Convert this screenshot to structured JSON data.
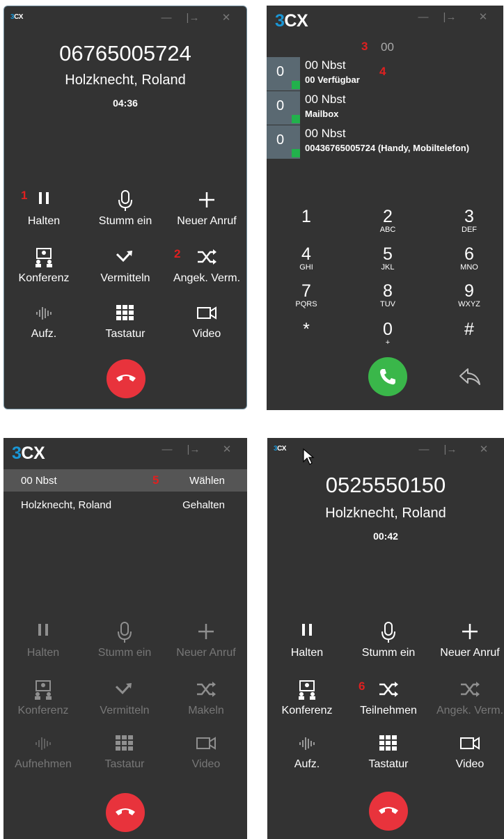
{
  "app": {
    "logo_prefix": "3",
    "logo_rest": "CX"
  },
  "window": {
    "minimize": "—",
    "dock": "|→",
    "close": "✕"
  },
  "panel1": {
    "number": "06765005724",
    "name": "Holzknecht, Roland",
    "timer": "04:36",
    "markers": [
      "1",
      "2"
    ],
    "controls": [
      "Halten",
      "Stumm ein",
      "Neuer Anruf",
      "Konferenz",
      "Vermitteln",
      "Angek. Verm.",
      "Aufz.",
      "Tastatur",
      "Video"
    ]
  },
  "panel2": {
    "marker3": "3",
    "marker4": "4",
    "dial_value": "00",
    "contacts": [
      {
        "avatar": "0",
        "name": "00 Nbst",
        "status": "00 Verfügbar"
      },
      {
        "avatar": "0",
        "name": "00 Nbst",
        "status": "Mailbox"
      },
      {
        "avatar": "0",
        "name": "00 Nbst",
        "status": "00436765005724 (Handy, Mobiltelefon)"
      }
    ],
    "keys": [
      {
        "d": "1",
        "l": ""
      },
      {
        "d": "2",
        "l": "ABC"
      },
      {
        "d": "3",
        "l": "DEF"
      },
      {
        "d": "4",
        "l": "GHI"
      },
      {
        "d": "5",
        "l": "JKL"
      },
      {
        "d": "6",
        "l": "MNO"
      },
      {
        "d": "7",
        "l": "PQRS"
      },
      {
        "d": "8",
        "l": "TUV"
      },
      {
        "d": "9",
        "l": "WXYZ"
      },
      {
        "d": "*",
        "l": ""
      },
      {
        "d": "0",
        "l": "+"
      },
      {
        "d": "#",
        "l": ""
      }
    ]
  },
  "panel3": {
    "marker5": "5",
    "rows": [
      {
        "name": "00 Nbst",
        "status": "Wählen"
      },
      {
        "name": "Holzknecht, Roland",
        "status": "Gehalten"
      }
    ],
    "controls": [
      "Halten",
      "Stumm ein",
      "Neuer Anruf",
      "Konferenz",
      "Vermitteln",
      "Makeln",
      "Aufnehmen",
      "Tastatur",
      "Video"
    ]
  },
  "panel4": {
    "number": "0525550150",
    "name": "Holzknecht, Roland",
    "timer": "00:42",
    "marker6": "6",
    "controls": [
      "Halten",
      "Stumm ein",
      "Neuer Anruf",
      "Konferenz",
      "Teilnehmen",
      "Angek. Verm.",
      "Aufz.",
      "Tastatur",
      "Video"
    ]
  },
  "colors": {
    "panel_bg": "#333333",
    "accent_blue": "#1a96d5",
    "hangup_red": "#e8333c",
    "call_green": "#3ab74a",
    "presence_green": "#22b14c",
    "marker_red": "#e02020"
  }
}
